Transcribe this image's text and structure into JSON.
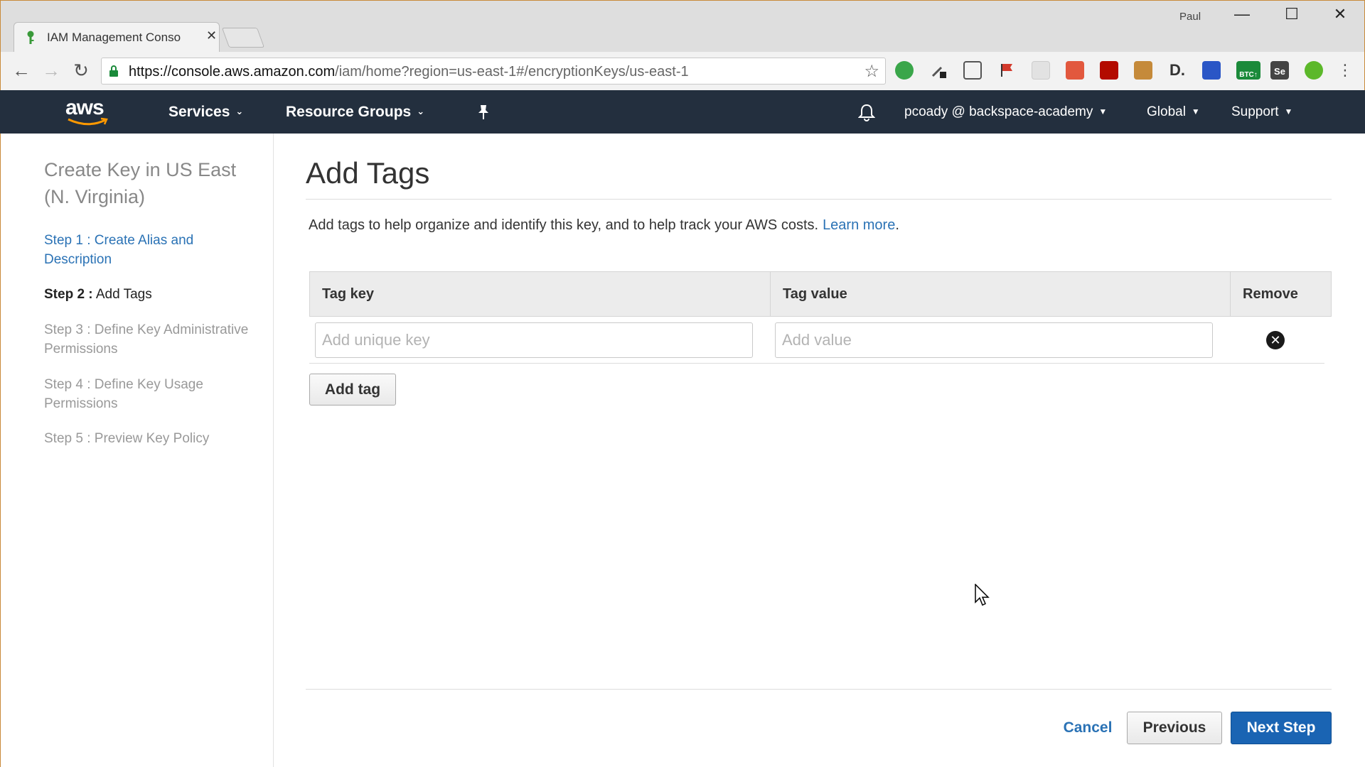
{
  "browser": {
    "tab_title": "IAM Management Conso",
    "profile_name": "Paul",
    "url_host": "https://console.aws.amazon.com",
    "url_path": "/iam/home?region=us-east-1#/encryptionKeys/us-east-1",
    "extensions": [
      {
        "name": "refresh-ext-icon",
        "color": "#3aa64a"
      },
      {
        "name": "eyedropper-ext-icon",
        "color": "#444444"
      },
      {
        "name": "screenshot-ext-icon",
        "color": "#555555"
      },
      {
        "name": "flag-ext-icon",
        "color": "#d33a2c"
      },
      {
        "name": "grid-ext-icon",
        "color": "#bbbbbb"
      },
      {
        "name": "office-ext-icon",
        "color": "#e2583e"
      },
      {
        "name": "pdf-ext-icon",
        "color": "#b30b00"
      },
      {
        "name": "gift-ext-icon",
        "color": "#c58a3a"
      },
      {
        "name": "d-ext-icon",
        "color": "#333333"
      },
      {
        "name": "book-ext-icon",
        "color": "#2a56c6"
      },
      {
        "name": "btc-ext-icon",
        "color": "#1b8a3a"
      },
      {
        "name": "selenium-ext-icon",
        "color": "#444444"
      },
      {
        "name": "green-dot-ext-icon",
        "color": "#5cb82a"
      }
    ],
    "btc_label": "BTC↑",
    "se_label": "Se",
    "d_label": "D."
  },
  "aws_nav": {
    "logo_text": "aws",
    "services": "Services",
    "resource_groups": "Resource Groups",
    "account": "pcoady @ backspace-academy",
    "region": "Global",
    "support": "Support"
  },
  "sidebar": {
    "title": "Create Key in US East (N. Virginia)",
    "steps": [
      {
        "label": "Step 1",
        "text": "Create Alias and Description"
      },
      {
        "label": "Step 2",
        "text": "Add Tags"
      },
      {
        "label": "Step 3",
        "text": "Define Key Administrative Permissions"
      },
      {
        "label": "Step 4",
        "text": "Define Key Usage Permissions"
      },
      {
        "label": "Step 5",
        "text": "Preview Key Policy"
      }
    ]
  },
  "main": {
    "title": "Add Tags",
    "description": "Add tags to help organize and identify this key, and to help track your AWS costs.",
    "learn_more": "Learn more",
    "columns": [
      "Tag key",
      "Tag value",
      "Remove"
    ],
    "key_placeholder": "Add unique key",
    "value_placeholder": "Add value",
    "add_tag": "Add tag"
  },
  "footer": {
    "cancel": "Cancel",
    "previous": "Previous",
    "next": "Next Step"
  },
  "colors": {
    "aws_nav_bg": "#232f3e",
    "link": "#2a72b5",
    "primary": "#1a64b3"
  }
}
